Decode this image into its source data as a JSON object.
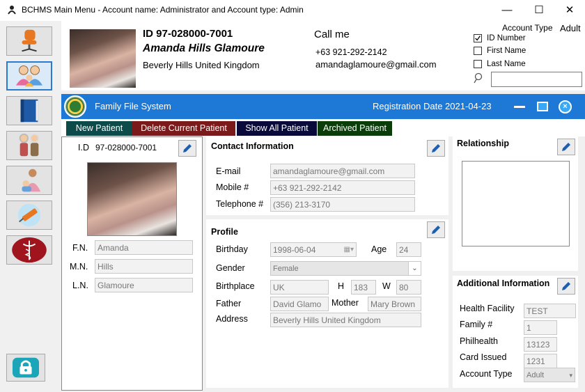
{
  "window": {
    "title": "BCHMS Main Menu  - Account name: Administrator and  Account type: Admin",
    "minimize_glyph": "—",
    "maximize_glyph": "☐",
    "close_glyph": "✕"
  },
  "rail": {
    "items": [
      "chair-icon",
      "family-icon",
      "book-icon",
      "elderly-icon",
      "mother-child-icon",
      "vaccine-icon",
      "medical-caduceus-icon"
    ],
    "active_index": 1,
    "lock": "lock-icon"
  },
  "header": {
    "id_line": "ID  97-028000-7001",
    "name": "Amanda Hills Glamoure",
    "address": "Beverly Hills United Kingdom",
    "call_label": "Call me",
    "phone": "+63 921-292-2142",
    "email": "amandaglamoure@gmail.com",
    "account_type_label": "Account Type",
    "account_type_value": "Adult",
    "search_options": [
      {
        "label": "ID Number",
        "checked": true
      },
      {
        "label": "First Name",
        "checked": false
      },
      {
        "label": "Last Name",
        "checked": false
      }
    ],
    "search_value": ""
  },
  "bluebar": {
    "title": "Family File System",
    "reg_date": "Registration Date 2021-04-23"
  },
  "tabs": [
    {
      "label": "New Patient",
      "color": "#0d4a4a"
    },
    {
      "label": "Delete Current Patient",
      "color": "#7a1a1a"
    },
    {
      "label": "Show All Patient",
      "color": "#0a0a3a"
    },
    {
      "label": "Archived Patient",
      "color": "#0b3d0b"
    }
  ],
  "left_panel": {
    "id_label": "I.D",
    "id_value": "97-028000-7001",
    "fn_label": "F.N.",
    "fn_value": "Amanda",
    "mn_label": "M.N.",
    "mn_value": "Hills",
    "ln_label": "L.N.",
    "ln_value": "Glamoure"
  },
  "contact": {
    "title": "Contact Information",
    "email_label": "E-mail",
    "email_value": "amandaglamoure@gmail.com",
    "mobile_label": "Mobile #",
    "mobile_value": "+63 921-292-2142",
    "tel_label": "Telephone #",
    "tel_value": "(356) 213-3170"
  },
  "profile": {
    "title": "Profile",
    "birthday_label": "Birthday",
    "birthday_value": "1998-06-04",
    "age_label": "Age",
    "age_value": "24",
    "gender_label": "Gender",
    "gender_value": "Female",
    "birthplace_label": "Birthplace",
    "birthplace_value": "UK",
    "h_label": "H",
    "h_value": "183",
    "w_label": "W",
    "w_value": "80",
    "father_label": "Father",
    "father_value": "David Glamo",
    "mother_label": "Mother",
    "mother_value": "Mary Brown",
    "address_label": "Address",
    "address_value": "Beverly Hills United Kingdom"
  },
  "relationship": {
    "title": "Relationship"
  },
  "additional": {
    "title": "Additional Information",
    "facility_label": "Health Facility",
    "facility_value": "TEST",
    "family_label": "Family #",
    "family_value": "1",
    "philhealth_label": "Philhealth",
    "philhealth_value": "13123",
    "card_label": "Card Issued",
    "card_value": "1231",
    "acct_label": "Account Type",
    "acct_value": "Adult"
  }
}
